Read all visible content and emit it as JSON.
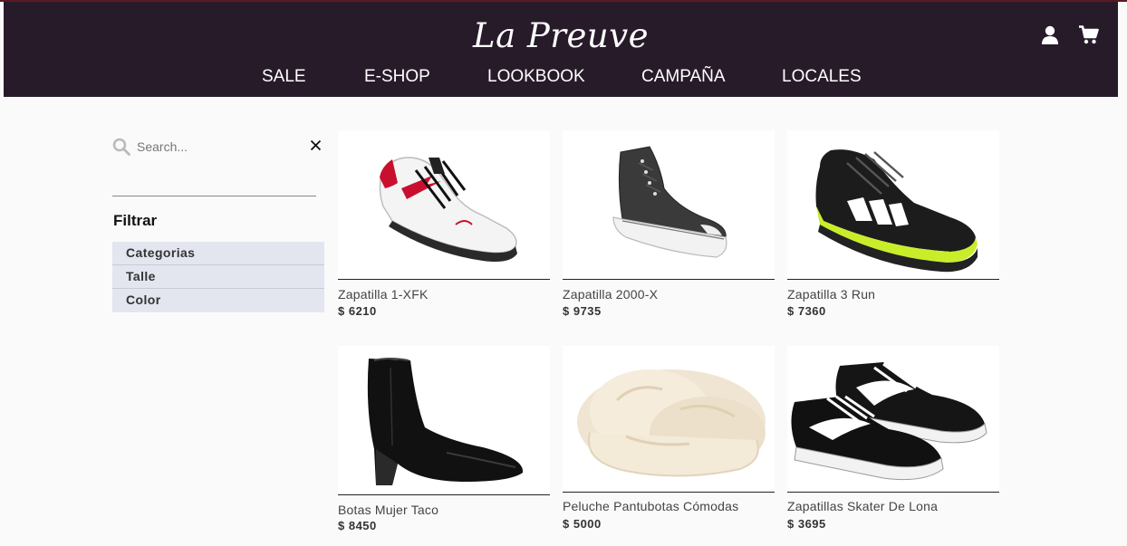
{
  "brand": {
    "logo_text": "La Preuve"
  },
  "nav": {
    "items": [
      "SALE",
      "E-SHOP",
      "LOOKBOOK",
      "CAMPAÑA",
      "LOCALES"
    ]
  },
  "header_icons": {
    "account": "user-icon",
    "cart": "cart-icon"
  },
  "search": {
    "placeholder": "Search...",
    "value": "",
    "clear": "close-icon",
    "icon": "search-icon"
  },
  "filters": {
    "title": "Filtrar",
    "items": [
      "Categorias",
      "Talle",
      "Color"
    ]
  },
  "products": [
    {
      "name": "Zapatilla 1-XFK",
      "price": "$ 6210",
      "image": "white-tennis-sneaker"
    },
    {
      "name": "Zapatilla 2000-X",
      "price": "$ 9735",
      "image": "black-high-top-sneaker"
    },
    {
      "name": "Zapatilla 3 Run",
      "price": "$ 7360",
      "image": "black-running-shoe"
    },
    {
      "name": "Botas Mujer Taco",
      "price": "$ 8450",
      "image": "black-heeled-boot"
    },
    {
      "name": "Peluche Pantubotas Cómodas",
      "price": "$ 5000",
      "image": "fluffy-slipper"
    },
    {
      "name": "Zapatillas Skater De Lona",
      "price": "$ 3695",
      "image": "black-skate-shoes"
    }
  ],
  "colors": {
    "header_bg": "#271b2a",
    "filter_bg": "#e3e6ef",
    "page_bg": "#fafafa"
  }
}
